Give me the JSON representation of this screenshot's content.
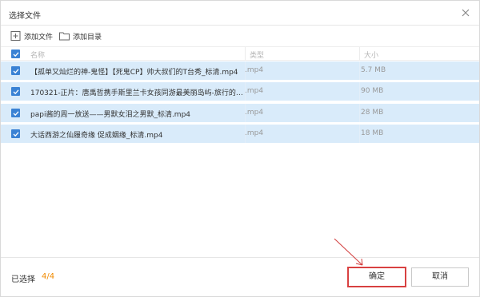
{
  "dialog": {
    "title": "选择文件",
    "close_icon": "close-icon"
  },
  "toolbar": {
    "add_file_label": "添加文件",
    "add_dir_label": "添加目录"
  },
  "table": {
    "columns": [
      "名称",
      "类型",
      "大小"
    ],
    "rows": [
      {
        "name": "【孤单又灿烂的神-鬼怪】【死鬼CP】帅大叔们的T台秀_标清.mp4",
        "type": ".mp4",
        "size": "5.7 MB",
        "checked": true
      },
      {
        "name": "170321-正片：唐禹哲携手斯里兰卡女孩同游最美丽岛屿-旅行的声音...",
        "type": ".mp4",
        "size": "90 MB",
        "checked": true
      },
      {
        "name": "papi酱的周一放送——男默女泪之男默_标清.mp4",
        "type": ".mp4",
        "size": "28 MB",
        "checked": true
      },
      {
        "name": "大话西游之仙履奇缘 促成姻缘_标清.mp4",
        "type": ".mp4",
        "size": "18 MB",
        "checked": true
      }
    ]
  },
  "footer": {
    "selected_label": "已选择",
    "selected_count": "4/4",
    "ok_label": "确定",
    "cancel_label": "取消"
  },
  "colors": {
    "accent": "#3a82d4",
    "row_selected": "#d9ebfa",
    "count": "#f08a00",
    "annotation": "#d23c3c"
  }
}
